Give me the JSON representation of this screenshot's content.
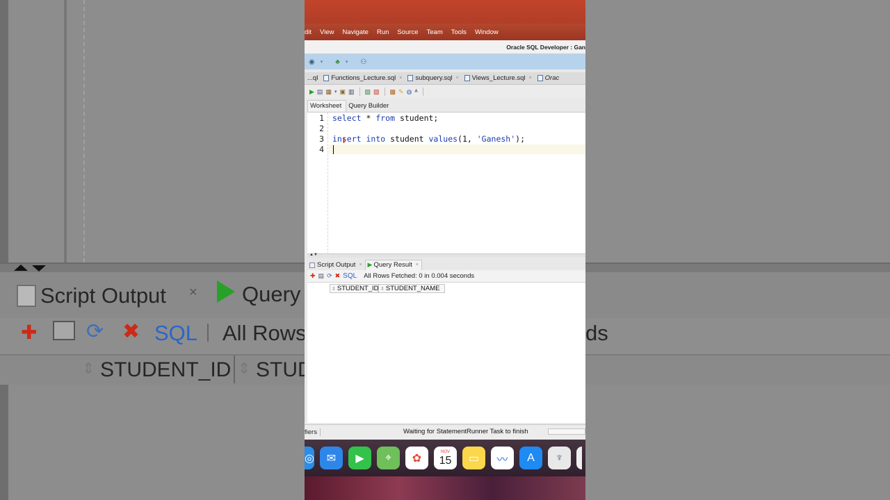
{
  "menubar": {
    "items": [
      "dit",
      "View",
      "Navigate",
      "Run",
      "Source",
      "Team",
      "Tools",
      "Window"
    ]
  },
  "window_title": "Oracle SQL Developer : Gan",
  "file_tabs": [
    {
      "label": "...ql"
    },
    {
      "label": "Functions_Lecture.sql"
    },
    {
      "label": "subquery.sql"
    },
    {
      "label": "Views_Lecture.sql"
    },
    {
      "label": "Orac"
    }
  ],
  "editor_subtabs": {
    "worksheet": "Worksheet",
    "query_builder": "Query Builder"
  },
  "editor": {
    "line_numbers": [
      "1",
      "2",
      "3",
      "4"
    ],
    "line1": {
      "kw1": "select",
      "rest1": " * ",
      "kw2": "from",
      "rest2": " student;"
    },
    "line3": {
      "kw1": "insert",
      "rest1": " ",
      "kw2": "into",
      "rest2": " student ",
      "kw3": "values",
      "rest3": "(1, ",
      "str": "'Ganesh'",
      "rest4": ");"
    }
  },
  "result_tabs": {
    "script_output": "Script Output",
    "query_result": "Query Result"
  },
  "result_toolbar": {
    "sql": "SQL",
    "message": "All Rows Fetched: 0 in 0.004 seconds"
  },
  "result_columns": [
    "STUDENT_ID",
    "STUDENT_NAME"
  ],
  "status": {
    "left": "fiers",
    "message": "Waiting for StatementRunner Task  to finish"
  },
  "dock": {
    "calendar_month": "NOV",
    "calendar_day": "15"
  },
  "background_zoom": {
    "script_output": "Script Output",
    "query": "Query",
    "sql": "SQL",
    "all_rows": "All Rows",
    "ds": "ds",
    "student_id": "STUDENT_ID",
    "stud": "STUD"
  },
  "colors": {
    "menubar_top": "#c2442a",
    "keyword": "#1a3cb0",
    "nav_bar": "#b7d3ec",
    "current_line": "#fbf7e6"
  }
}
